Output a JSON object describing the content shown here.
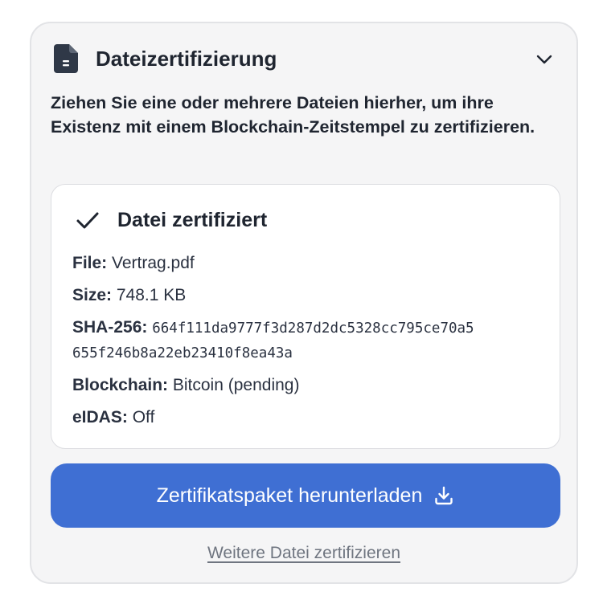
{
  "header": {
    "title": "Dateizertifizierung",
    "icon": "file-text-icon",
    "toggle_icon": "chevron-down-icon"
  },
  "description": "Ziehen Sie eine oder mehrere Dateien hierher, um ihre Existenz mit einem Blockchain-Zeitstempel zu zertifizieren.",
  "result": {
    "status_icon": "check-icon",
    "title": "Datei zertifiziert",
    "file_label": "File:",
    "file_value": "Vertrag.pdf",
    "size_label": "Size:",
    "size_value": "748.1 KB",
    "hash_label": "SHA-256:",
    "hash_line1": "664f111da9777f3d287d2dc5328cc795ce70a5",
    "hash_line2": "655f246b8a22eb23410f8ea43a",
    "chain_label": "Blockchain:",
    "chain_value": "Bitcoin (pending)",
    "eidas_label": "eIDAS:",
    "eidas_value": "Off"
  },
  "actions": {
    "download_label": "Zertifikatspaket herunterladen",
    "download_icon": "download-icon",
    "another_label": "Weitere Datei zertifizieren"
  },
  "colors": {
    "accent": "#3f6fd3",
    "panel_bg": "#f5f5f6",
    "text": "#1f2530",
    "muted": "#6f7580"
  }
}
